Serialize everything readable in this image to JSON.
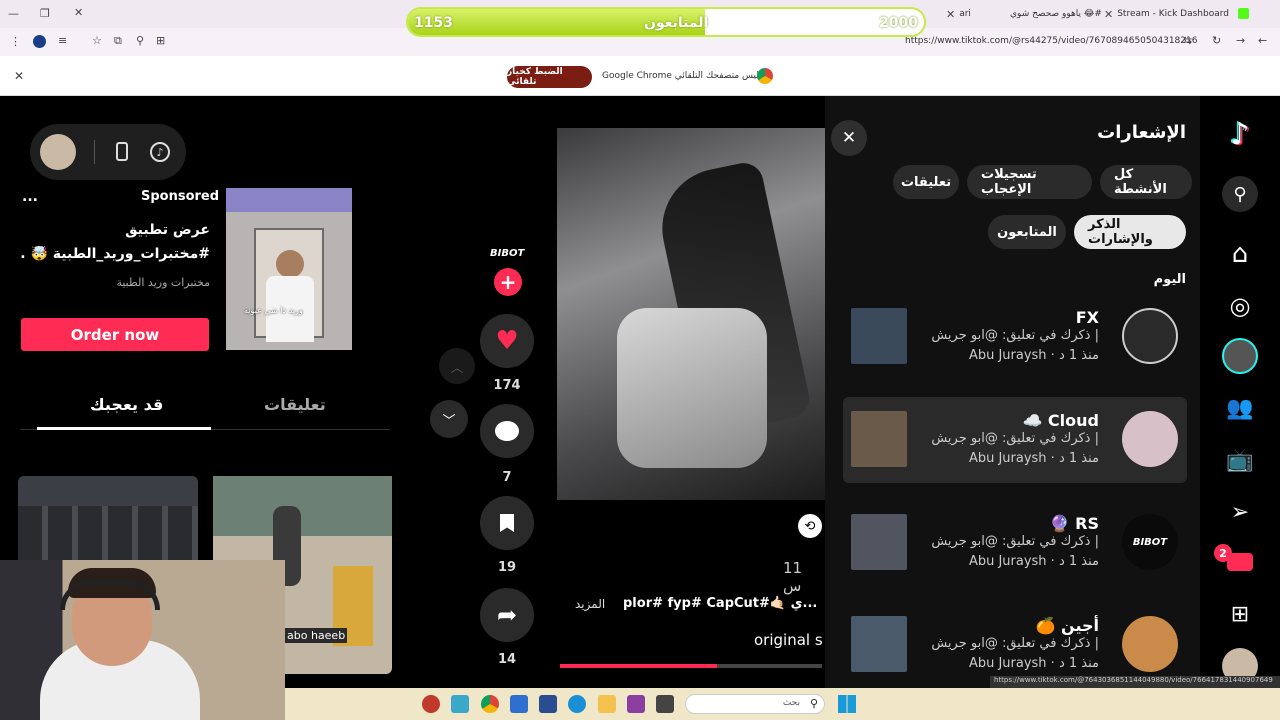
{
  "browser": {
    "tabs": [
      {
        "label": "Stream - Kick Dashboard",
        "color": "#53fc18"
      },
      {
        "label": "ياهوو صحصح شوي 😂#",
        "color": "#000000"
      },
      {
        "label": "ari",
        "color": "#000000"
      }
    ],
    "url": "https://www.tiktok.com/@rs44275/video/7670894650504318216",
    "infobar_text": "Google Chrome ليس متصفحك التلقائي.",
    "infobar_button": "الضبط كخيار تلقائي",
    "status_url": "https://www.tiktok.com/@7643036851144049880/video/766417831440907649"
  },
  "follower_goal": {
    "label": "المتابعون",
    "current": "1153",
    "goal": "2000",
    "progress": 0.576
  },
  "left_panel": {
    "ad_label": "Sponsored",
    "ad_title": "عرض تطبيق",
    "ad_subtitle": "#مختبرات_وريد_الطبية 🤯 ...",
    "ad_brand": "مختبرات وريد الطبية",
    "ad_cta": "Order now",
    "ad_thumb_caption": "وريد ذا شي عيونه",
    "tabs": [
      "تعليقات",
      "قد يعجبك"
    ],
    "active_tab": "قد يعجبك",
    "video_thumb_caption": "abo haeeb",
    "more": "..."
  },
  "video": {
    "author_badge": "BIBOT",
    "likes": "174",
    "comments": "7",
    "saves": "19",
    "shares": "14",
    "time": "11 س",
    "caption": "plor# fyp# CapCut#🤙🏻 ي...",
    "more_label": "المزيد",
    "sound": "original s",
    "progress": 0.6
  },
  "notifications": {
    "title": "الإشعارات",
    "filters": [
      "كل الأنشطة",
      "تسجيلات الإعجاب",
      "تعليقات",
      "الذكر والإشارات",
      "المتابعون"
    ],
    "active_filter": "الذكر والإشارات",
    "section": "اليوم",
    "items": [
      {
        "name": "FX",
        "line1": "ذكرك في تعليق: @ابو جريش |",
        "line2": "Abu Juraysh · منذ 1 د",
        "thumb_color": "#3a4a5a",
        "avatar_color": "#2a2a2a",
        "highlight": false
      },
      {
        "name": "☁️ Cloud",
        "line1": "ذكرك في تعليق: @ابو جريش |",
        "line2": "Abu Juraysh · منذ 1 د",
        "thumb_color": "#6a5a4a",
        "avatar_color": "#d8c0c8",
        "highlight": true
      },
      {
        "name": "🔮 RS",
        "line1": "ذكرك في تعليق: @ابو جريش |",
        "line2": "Abu Juraysh · منذ 1 د",
        "thumb_color": "#505560",
        "avatar_color": "#0a0a0a",
        "highlight": false
      },
      {
        "name": "🍊 أجين",
        "line1": "ذكرك في تعليق: @ابو جريش |",
        "line2": "Abu Juraysh · منذ 1 د",
        "thumb_color": "#4a5a6a",
        "avatar_color": "#c98a4a",
        "highlight": false
      }
    ]
  },
  "sidebar": {
    "messages_badge": "2"
  },
  "taskbar": {
    "search_placeholder": "بحث"
  }
}
